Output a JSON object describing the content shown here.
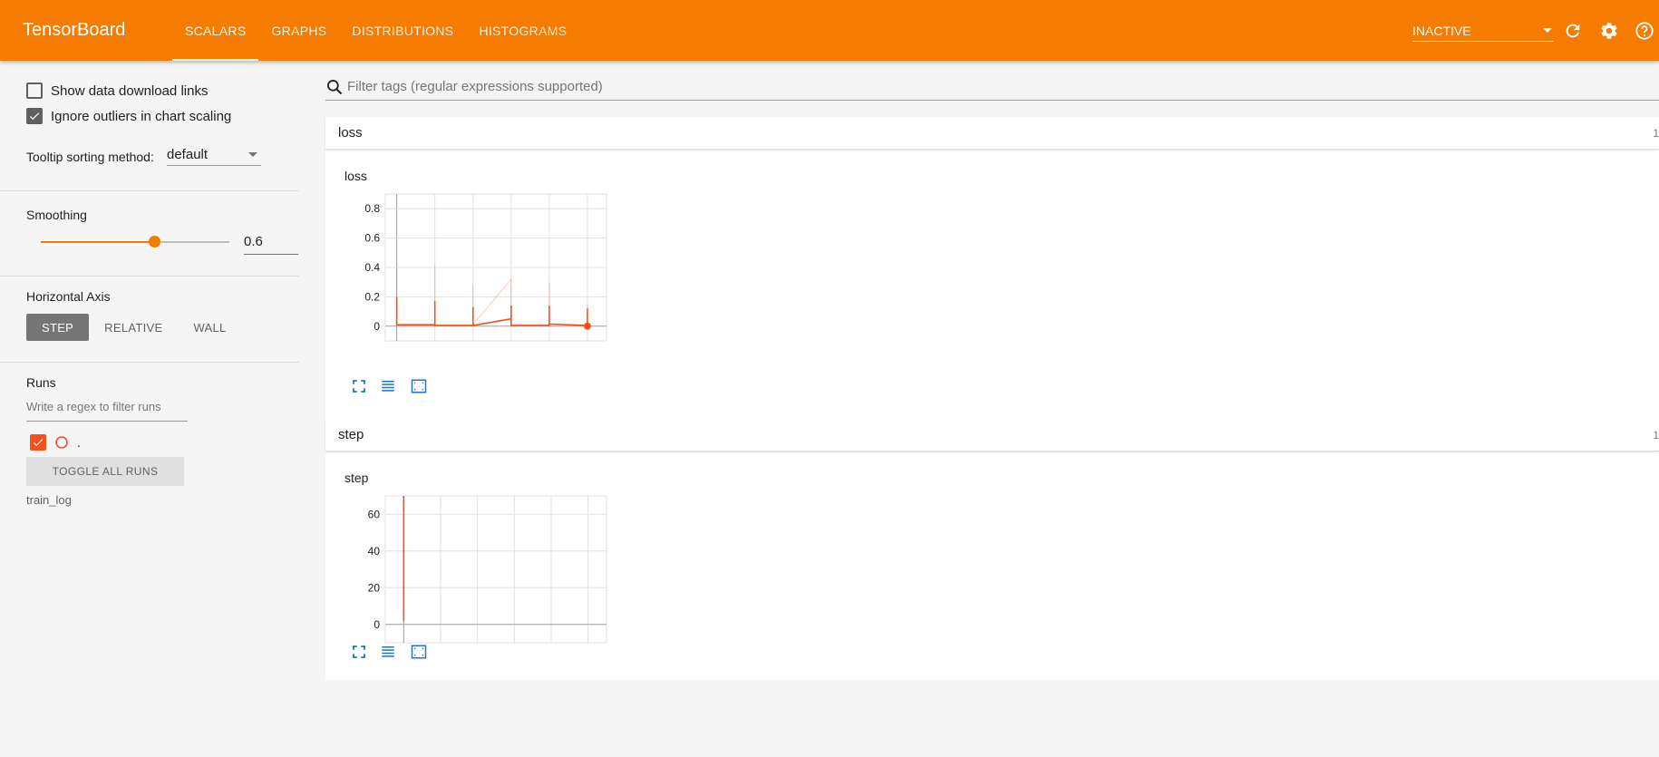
{
  "header": {
    "brand": "TensorBoard",
    "tabs": [
      {
        "label": "SCALARS",
        "active": true
      },
      {
        "label": "GRAPHS",
        "active": false
      },
      {
        "label": "DISTRIBUTIONS",
        "active": false
      },
      {
        "label": "HISTOGRAMS",
        "active": false
      }
    ],
    "status_select": "INACTIVE",
    "icons": [
      "refresh-icon",
      "gear-icon",
      "help-icon"
    ]
  },
  "sidebar": {
    "show_download_links": {
      "label": "Show data download links",
      "checked": false
    },
    "ignore_outliers": {
      "label": "Ignore outliers in chart scaling",
      "checked": true
    },
    "tooltip_sorting": {
      "label": "Tooltip sorting method:",
      "value": "default"
    },
    "smoothing": {
      "label": "Smoothing",
      "value": "0.6",
      "fraction": 0.6
    },
    "horizontal_axis": {
      "label": "Horizontal Axis",
      "options": [
        "STEP",
        "RELATIVE",
        "WALL"
      ],
      "selected": "STEP"
    },
    "runs": {
      "label": "Runs",
      "filter_placeholder": "Write a regex to filter runs",
      "items": [
        {
          "name": ".",
          "checked": true
        }
      ],
      "toggle_all_label": "TOGGLE ALL RUNS",
      "log_dir": "train_log"
    }
  },
  "main": {
    "search_placeholder": "Filter tags (regular expressions supported)",
    "cards": [
      {
        "tag": "loss",
        "count": "1",
        "chart_title": "loss"
      },
      {
        "tag": "step",
        "count": "1",
        "chart_title": "step"
      }
    ]
  },
  "colors": {
    "accent": "#f57c00",
    "series": "#f4511e"
  },
  "chart_data": [
    {
      "type": "line",
      "title": "loss",
      "x_ticks": [
        "0",
        "1",
        "2",
        "3",
        "4",
        "5"
      ],
      "y_ticks": [
        "0",
        "0.2",
        "0.4",
        "0.6",
        "0.8"
      ],
      "xlim": [
        -0.3,
        5.5
      ],
      "ylim": [
        -0.1,
        0.9
      ],
      "grid": true,
      "series": [
        {
          "raw": [
            [
              0,
              0.42
            ],
            [
              0,
              0.01
            ],
            [
              1,
              0.01
            ],
            [
              1,
              0.42
            ],
            [
              1,
              0.01
            ],
            [
              2,
              0.01
            ],
            [
              2,
              0.28
            ],
            [
              2,
              0.01
            ],
            [
              3,
              0.32
            ],
            [
              3,
              0.01
            ],
            [
              4,
              0.01
            ],
            [
              4,
              0.3
            ],
            [
              4,
              0.01
            ],
            [
              5,
              0.01
            ],
            [
              5,
              0.15
            ],
            [
              5,
              0.0
            ]
          ],
          "smoothed": [
            [
              0,
              0.2
            ],
            [
              0,
              0.01
            ],
            [
              1,
              0.01
            ],
            [
              1,
              0.17
            ],
            [
              1,
              0.005
            ],
            [
              2,
              0.005
            ],
            [
              2,
              0.13
            ],
            [
              2,
              0.005
            ],
            [
              3,
              0.05
            ],
            [
              3,
              0.14
            ],
            [
              3,
              0.005
            ],
            [
              4,
              0.005
            ],
            [
              4,
              0.14
            ],
            [
              4,
              0.015
            ],
            [
              5,
              0.005
            ],
            [
              5,
              0.12
            ],
            [
              5,
              0.0
            ]
          ]
        }
      ]
    },
    {
      "type": "line",
      "title": "step",
      "x_ticks": [
        "0",
        "1",
        "2",
        "3",
        "4",
        "5"
      ],
      "y_ticks": [
        "0",
        "20",
        "40",
        "60"
      ],
      "xlim": [
        -0.5,
        5.5
      ],
      "ylim": [
        -10,
        70
      ],
      "grid": true,
      "series": [
        {
          "raw": [
            [
              0,
              70
            ],
            [
              0,
              2
            ]
          ],
          "smoothed": [
            [
              0,
              70
            ],
            [
              0,
              2
            ]
          ]
        }
      ]
    }
  ]
}
